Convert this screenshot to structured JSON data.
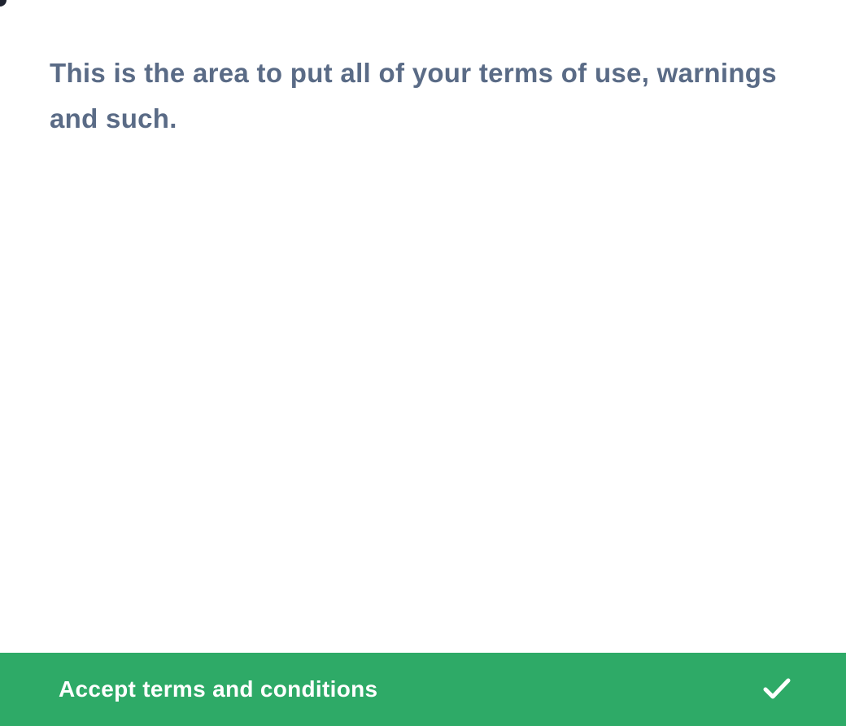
{
  "terms": {
    "text": "This is the area to put all of your terms of use, warnings and such."
  },
  "accept_button": {
    "label": "Accept terms and conditions",
    "icon": "checkmark-icon"
  },
  "colors": {
    "accent": "#2eaa67",
    "text": "#5a6b86",
    "background": "#ffffff"
  }
}
